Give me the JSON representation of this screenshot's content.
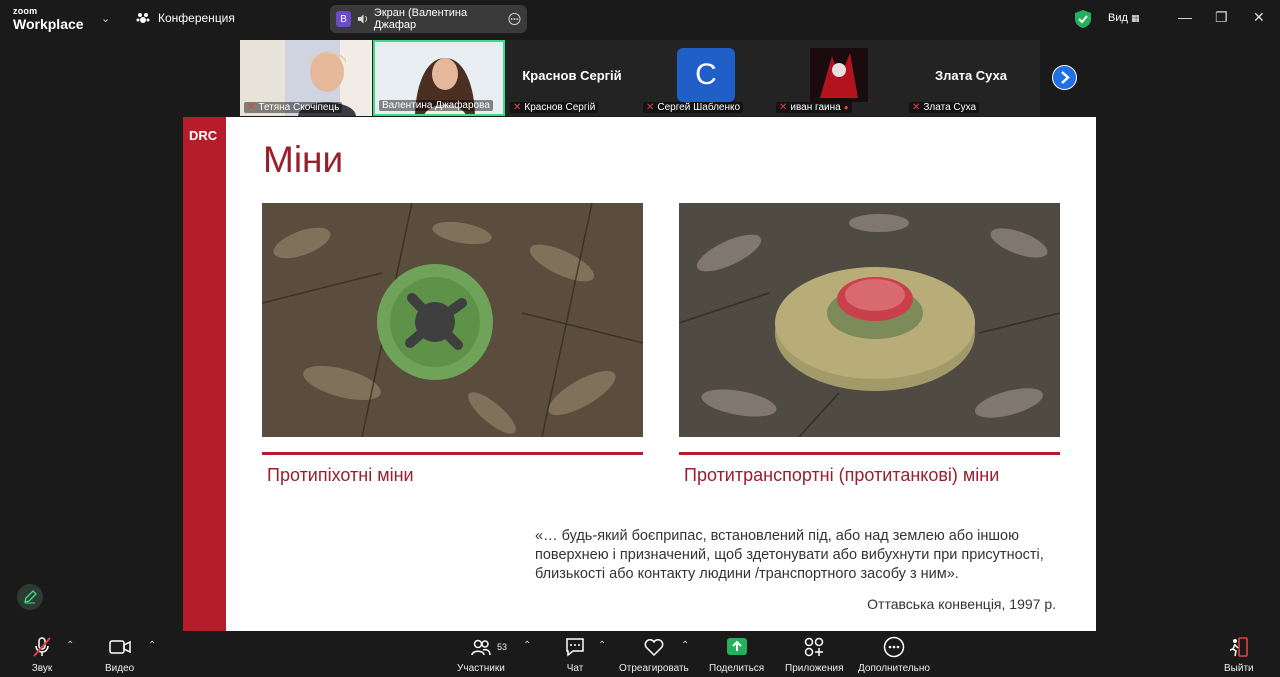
{
  "titlebar": {
    "brand_top": "zoom",
    "brand_bottom": "Workplace",
    "meeting_label": "Конференция",
    "share_avatar_letter": "В",
    "share_label": "Экран (Валентина Джафар",
    "view_label": "Вид"
  },
  "participants": [
    {
      "name": "Тетяна Скочіпець",
      "type": "video"
    },
    {
      "name": "Валентина Джафарова",
      "type": "video",
      "active": true
    },
    {
      "name": "Краснов Сергій",
      "display": "Краснов Сергій",
      "type": "name"
    },
    {
      "name": "Сергей Шабленко",
      "display": "С",
      "type": "avatar",
      "color": "#1f5fc7"
    },
    {
      "name": "иван гаина",
      "type": "image"
    },
    {
      "name": "Злата Суха",
      "display": "Злата Суха",
      "type": "name"
    }
  ],
  "slide": {
    "logo": "DRC",
    "title": "Міни",
    "left_caption": "Протипіхотні міни",
    "right_caption": "Протитранспортні (протитанкові) міни",
    "quote": "«… будь-який боєприпас, встановлений під, або над землею або іншою поверхнею і призначений, щоб здетонувати або вибухнути при присутності, близькості або контакту людини /транспортного засобу з ним».",
    "source": "Оттавська конвенція, 1997 р."
  },
  "toolbar": {
    "audio": "Звук",
    "video": "Видео",
    "participants": "Участники",
    "participants_count": "53",
    "chat": "Чат",
    "react": "Отреагировать",
    "share": "Поделиться",
    "apps": "Приложения",
    "more": "Дополнительно",
    "leave": "Выйти"
  },
  "colors": {
    "accent_red": "#b71c2a",
    "share_green": "#23b25b",
    "active_border": "#3ddc84"
  }
}
